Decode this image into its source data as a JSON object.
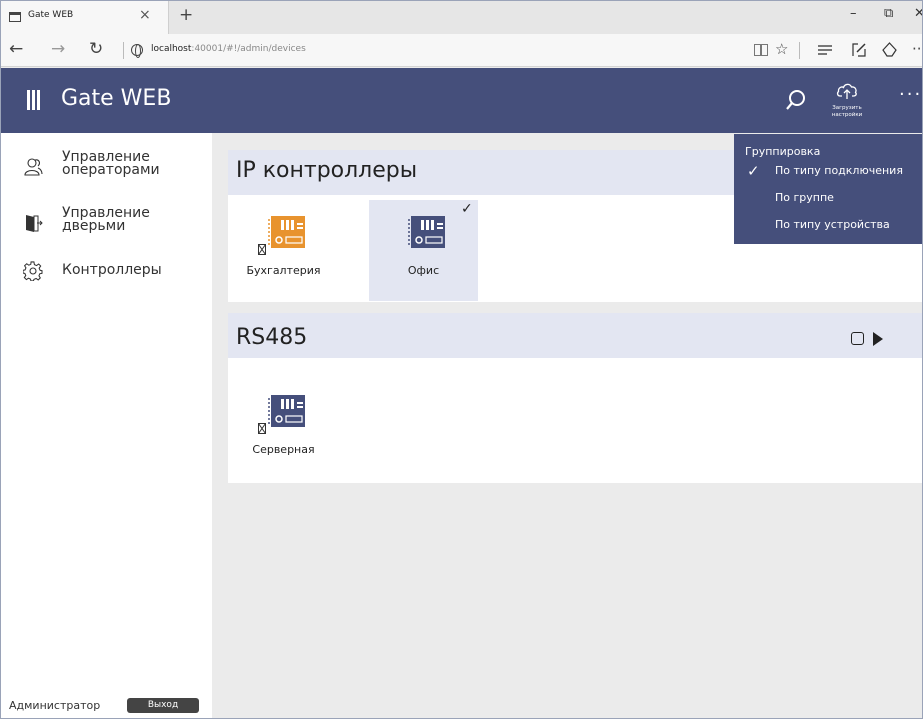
{
  "browser": {
    "tab_title": "Gate WEB",
    "tab_close": "×",
    "new_tab": "+",
    "url_host": "localhost",
    "url_rest": ":40001/#!/admin/devices",
    "back": "←",
    "forward": "→",
    "refresh": "↻",
    "minimize": "–",
    "restore": "⧉",
    "close": "✕"
  },
  "app": {
    "title": "Gate WEB",
    "upload_label_line1": "Загрузить",
    "upload_label_line2": "настройки",
    "more": "···"
  },
  "sidebar": {
    "items": [
      {
        "icon": "operators-icon",
        "line1": "Управление",
        "line2": "операторами"
      },
      {
        "icon": "doors-icon",
        "line1": "Управление",
        "line2": "дверьми"
      },
      {
        "icon": "gear-icon",
        "line1": "Контроллеры",
        "line2": ""
      }
    ],
    "user": "Администратор",
    "logout": "Выход"
  },
  "groups": [
    {
      "title": "IP контроллеры",
      "devices": [
        {
          "name": "Бухгалтерия",
          "color": "#e8932e",
          "offline": true,
          "selected": false
        },
        {
          "name": "Офис",
          "color": "#454f7b",
          "offline": false,
          "selected": true
        }
      ]
    },
    {
      "title": "RS485",
      "devices": [
        {
          "name": "Серверная",
          "color": "#454f7b",
          "offline": true,
          "selected": false
        }
      ]
    }
  ],
  "grouping_menu": {
    "title": "Группировка",
    "options": [
      {
        "label": "По типу подключения",
        "checked": true
      },
      {
        "label": "По группе",
        "checked": false
      },
      {
        "label": "По типу устройства",
        "checked": false
      }
    ]
  },
  "colors": {
    "accent": "#454f7b",
    "header_band": "#e3e6f2",
    "device_orange": "#e8932e"
  }
}
